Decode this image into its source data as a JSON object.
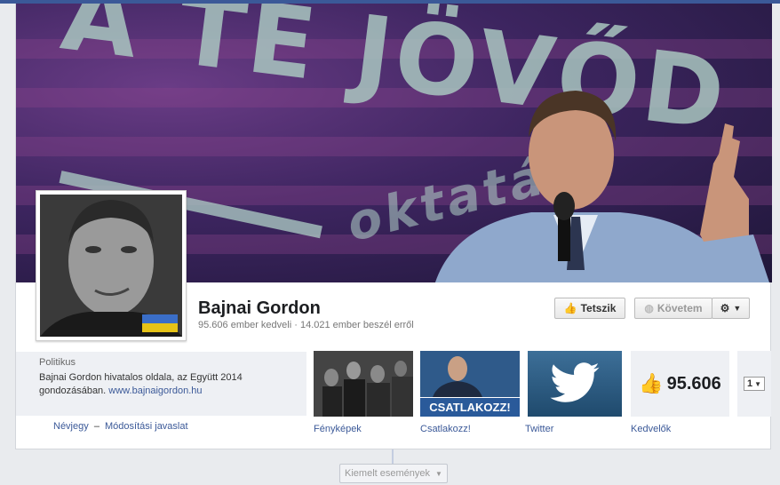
{
  "cover": {
    "big_text": "A TE JÖVŐD",
    "small_text": "oktatás"
  },
  "page": {
    "name": "Bajnai Gordon",
    "stats": "95.606 ember kedveli · 14.021 ember beszél erről"
  },
  "actions": {
    "like_label": "Tetszik",
    "follow_label": "Követem"
  },
  "about": {
    "category": "Politikus",
    "description": "Bajnai Gordon hivatalos oldala, az Együtt 2014 gondozásában.",
    "url": "www.bajnaigordon.hu",
    "link_about": "Névjegy",
    "link_separator": "–",
    "link_suggest": "Módosítási javaslat"
  },
  "apps": {
    "photos_label": "Fényképek",
    "join_label": "Csatlakozz!",
    "join_banner": "CSATLAKOZZ!",
    "twitter_label": "Twitter",
    "likes_label": "Kedvelők",
    "likes_count": "95.606",
    "more_count": "1"
  },
  "timeline": {
    "featured_label": "Kiemelt események"
  },
  "colors": {
    "brand": "#3b5998",
    "background": "#e9ebee"
  }
}
